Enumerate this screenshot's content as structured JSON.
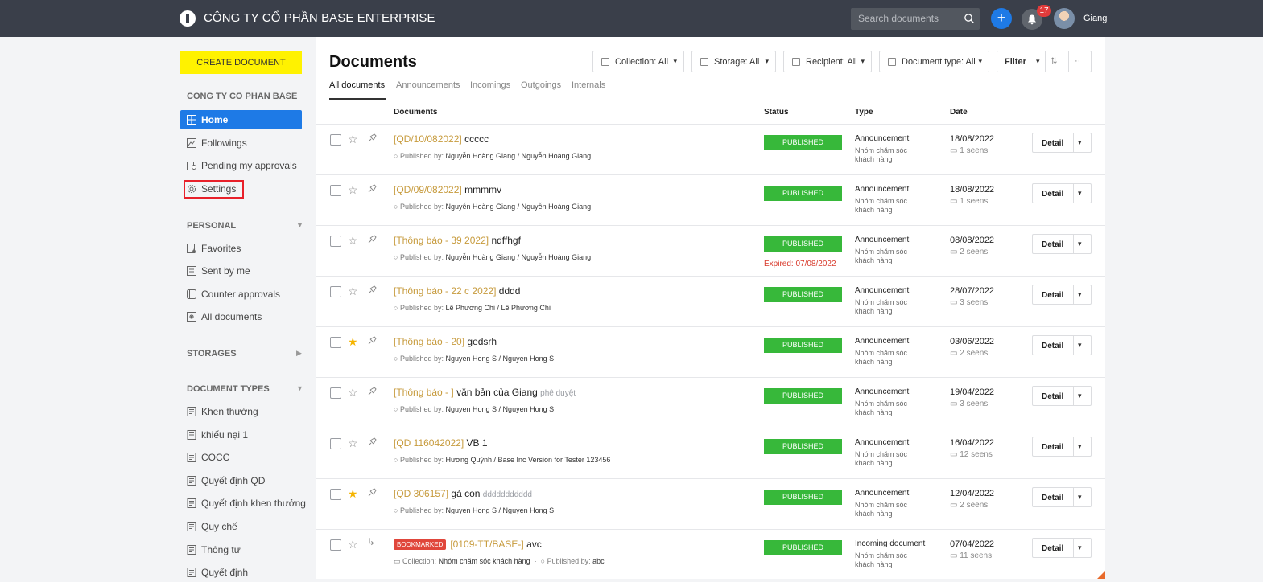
{
  "header": {
    "company": "CÔNG TY CỔ PHẦN BASE ENTERPRISE",
    "search_placeholder": "Search documents",
    "notification_count": "17",
    "username": "Giang",
    "plus_label": "+"
  },
  "sidebar": {
    "create_label": "CREATE DOCUMENT",
    "org_name": "CÔNG TY CỔ PHẦN BASE E.",
    "main_items": [
      {
        "label": "Home",
        "icon": "grid-icon"
      },
      {
        "label": "Followings",
        "icon": "image-icon"
      },
      {
        "label": "Pending my approvals",
        "icon": "approval-icon"
      },
      {
        "label": "Settings",
        "icon": "gear-icon"
      }
    ],
    "personal_title": "PERSONAL",
    "personal_items": [
      {
        "label": "Favorites",
        "icon": "star-doc-icon"
      },
      {
        "label": "Sent by me",
        "icon": "doc-icon"
      },
      {
        "label": "Counter approvals",
        "icon": "square-icon"
      },
      {
        "label": "All documents",
        "icon": "asterisk-icon"
      }
    ],
    "storages_title": "STORAGES",
    "doctypes_title": "DOCUMENT TYPES",
    "doctype_items": [
      {
        "label": "Khen thưởng"
      },
      {
        "label": "khiếu nại 1"
      },
      {
        "label": "COCC"
      },
      {
        "label": "Quyết định QD"
      },
      {
        "label": "Quyết định khen thưởng"
      },
      {
        "label": "Quy chế"
      },
      {
        "label": "Thông tư"
      },
      {
        "label": "Quyết định"
      }
    ]
  },
  "main": {
    "title": "Documents",
    "filters": {
      "collection": "Collection: All",
      "storage": "Storage: All",
      "recipient": "Recipient: All",
      "doctype": "Document type: All",
      "filter": "Filter"
    },
    "tabs": [
      "All documents",
      "Announcements",
      "Incomings",
      "Outgoings",
      "Internals"
    ],
    "columns": {
      "documents": "Documents",
      "status": "Status",
      "type": "Type",
      "date": "Date"
    },
    "rows": [
      {
        "code": "[QD/10/082022]",
        "name": "ccccc",
        "note": "",
        "bookmark": "",
        "collection_prefix": "",
        "collection": "",
        "pub_prefix": "Published by:",
        "publisher": "Nguyễn Hoàng Giang / Nguyễn Hoàng Giang",
        "status": "PUBLISHED",
        "expired": "",
        "type": "Announcement",
        "group": "Nhóm chăm sóc khách hàng",
        "date": "18/08/2022",
        "seens": "1 seens",
        "starred": false,
        "detail": "Detail"
      },
      {
        "code": "[QD/09/082022]",
        "name": "mmmmv",
        "note": "",
        "bookmark": "",
        "collection_prefix": "",
        "collection": "",
        "pub_prefix": "Published by:",
        "publisher": "Nguyễn Hoàng Giang / Nguyễn Hoàng Giang",
        "status": "PUBLISHED",
        "expired": "",
        "type": "Announcement",
        "group": "Nhóm chăm sóc khách hàng",
        "date": "18/08/2022",
        "seens": "1 seens",
        "starred": false,
        "detail": "Detail"
      },
      {
        "code": "[Thông báo - 39 2022]",
        "name": "ndffhgf",
        "note": "",
        "bookmark": "",
        "collection_prefix": "",
        "collection": "",
        "pub_prefix": "Published by:",
        "publisher": "Nguyễn Hoàng Giang / Nguyễn Hoàng Giang",
        "status": "PUBLISHED",
        "expired": "Expired: 07/08/2022",
        "type": "Announcement",
        "group": "Nhóm chăm sóc khách hàng",
        "date": "08/08/2022",
        "seens": "2 seens",
        "starred": false,
        "detail": "Detail"
      },
      {
        "code": "[Thông báo - 22 c 2022]",
        "name": "dddd",
        "note": "",
        "bookmark": "",
        "collection_prefix": "",
        "collection": "",
        "pub_prefix": "Published by:",
        "publisher": "Lê Phương Chi / Lê Phương Chi",
        "status": "PUBLISHED",
        "expired": "",
        "type": "Announcement",
        "group": "Nhóm chăm sóc khách hàng",
        "date": "28/07/2022",
        "seens": "3 seens",
        "starred": false,
        "detail": "Detail"
      },
      {
        "code": "[Thông báo - 20]",
        "name": "gedsrh",
        "note": "",
        "bookmark": "",
        "collection_prefix": "",
        "collection": "",
        "pub_prefix": "Published by:",
        "publisher": "Nguyen Hong S / Nguyen Hong S",
        "status": "PUBLISHED",
        "expired": "",
        "type": "Announcement",
        "group": "Nhóm chăm sóc khách hàng",
        "date": "03/06/2022",
        "seens": "2 seens",
        "starred": true,
        "detail": "Detail"
      },
      {
        "code": "[Thông báo - ]",
        "name": "văn bản của Giang",
        "note": "phê duyệt",
        "bookmark": "",
        "collection_prefix": "",
        "collection": "",
        "pub_prefix": "Published by:",
        "publisher": "Nguyen Hong S / Nguyen Hong S",
        "status": "PUBLISHED",
        "expired": "",
        "type": "Announcement",
        "group": "Nhóm chăm sóc khách hàng",
        "date": "19/04/2022",
        "seens": "3 seens",
        "starred": false,
        "detail": "Detail"
      },
      {
        "code": "[QD 116042022]",
        "name": "VB 1",
        "note": "",
        "bookmark": "",
        "collection_prefix": "",
        "collection": "",
        "pub_prefix": "Published by:",
        "publisher": "Hương Quỳnh / Base Inc Version for Tester 123456",
        "status": "PUBLISHED",
        "expired": "",
        "type": "Announcement",
        "group": "Nhóm chăm sóc khách hàng",
        "date": "16/04/2022",
        "seens": "12 seens",
        "starred": false,
        "detail": "Detail"
      },
      {
        "code": "[QD 306157]",
        "name": "gà con",
        "note": "ddddddddddd",
        "bookmark": "",
        "collection_prefix": "",
        "collection": "",
        "pub_prefix": "Published by:",
        "publisher": "Nguyen Hong S / Nguyen Hong S",
        "status": "PUBLISHED",
        "expired": "",
        "type": "Announcement",
        "group": "Nhóm chăm sóc khách hàng",
        "date": "12/04/2022",
        "seens": "2 seens",
        "starred": true,
        "detail": "Detail"
      },
      {
        "code": "[0109-TT/BASE-]",
        "name": "avc",
        "note": "",
        "bookmark": "BOOKMARKED",
        "collection_prefix": "Collection:",
        "collection": "Nhóm chăm sóc khách hàng",
        "pub_prefix": "Published by:",
        "publisher": "abc",
        "status": "PUBLISHED",
        "expired": "",
        "type": "Incoming document",
        "group": "Nhóm chăm sóc khách hàng",
        "date": "07/04/2022",
        "seens": "11 seens",
        "starred": false,
        "detail": "Detail"
      }
    ]
  }
}
